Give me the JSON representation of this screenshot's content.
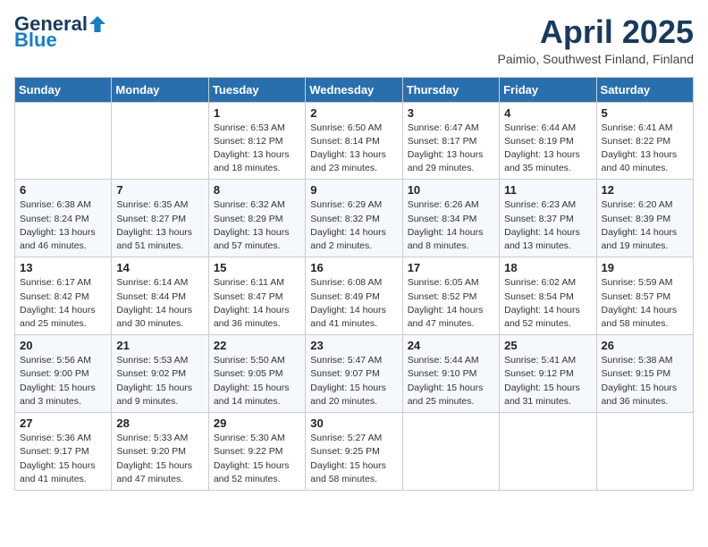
{
  "header": {
    "logo_general": "General",
    "logo_blue": "Blue",
    "month_title": "April 2025",
    "location": "Paimio, Southwest Finland, Finland"
  },
  "weekdays": [
    "Sunday",
    "Monday",
    "Tuesday",
    "Wednesday",
    "Thursday",
    "Friday",
    "Saturday"
  ],
  "weeks": [
    [
      {
        "day": "",
        "info": ""
      },
      {
        "day": "",
        "info": ""
      },
      {
        "day": "1",
        "info": "Sunrise: 6:53 AM\nSunset: 8:12 PM\nDaylight: 13 hours\nand 18 minutes."
      },
      {
        "day": "2",
        "info": "Sunrise: 6:50 AM\nSunset: 8:14 PM\nDaylight: 13 hours\nand 23 minutes."
      },
      {
        "day": "3",
        "info": "Sunrise: 6:47 AM\nSunset: 8:17 PM\nDaylight: 13 hours\nand 29 minutes."
      },
      {
        "day": "4",
        "info": "Sunrise: 6:44 AM\nSunset: 8:19 PM\nDaylight: 13 hours\nand 35 minutes."
      },
      {
        "day": "5",
        "info": "Sunrise: 6:41 AM\nSunset: 8:22 PM\nDaylight: 13 hours\nand 40 minutes."
      }
    ],
    [
      {
        "day": "6",
        "info": "Sunrise: 6:38 AM\nSunset: 8:24 PM\nDaylight: 13 hours\nand 46 minutes."
      },
      {
        "day": "7",
        "info": "Sunrise: 6:35 AM\nSunset: 8:27 PM\nDaylight: 13 hours\nand 51 minutes."
      },
      {
        "day": "8",
        "info": "Sunrise: 6:32 AM\nSunset: 8:29 PM\nDaylight: 13 hours\nand 57 minutes."
      },
      {
        "day": "9",
        "info": "Sunrise: 6:29 AM\nSunset: 8:32 PM\nDaylight: 14 hours\nand 2 minutes."
      },
      {
        "day": "10",
        "info": "Sunrise: 6:26 AM\nSunset: 8:34 PM\nDaylight: 14 hours\nand 8 minutes."
      },
      {
        "day": "11",
        "info": "Sunrise: 6:23 AM\nSunset: 8:37 PM\nDaylight: 14 hours\nand 13 minutes."
      },
      {
        "day": "12",
        "info": "Sunrise: 6:20 AM\nSunset: 8:39 PM\nDaylight: 14 hours\nand 19 minutes."
      }
    ],
    [
      {
        "day": "13",
        "info": "Sunrise: 6:17 AM\nSunset: 8:42 PM\nDaylight: 14 hours\nand 25 minutes."
      },
      {
        "day": "14",
        "info": "Sunrise: 6:14 AM\nSunset: 8:44 PM\nDaylight: 14 hours\nand 30 minutes."
      },
      {
        "day": "15",
        "info": "Sunrise: 6:11 AM\nSunset: 8:47 PM\nDaylight: 14 hours\nand 36 minutes."
      },
      {
        "day": "16",
        "info": "Sunrise: 6:08 AM\nSunset: 8:49 PM\nDaylight: 14 hours\nand 41 minutes."
      },
      {
        "day": "17",
        "info": "Sunrise: 6:05 AM\nSunset: 8:52 PM\nDaylight: 14 hours\nand 47 minutes."
      },
      {
        "day": "18",
        "info": "Sunrise: 6:02 AM\nSunset: 8:54 PM\nDaylight: 14 hours\nand 52 minutes."
      },
      {
        "day": "19",
        "info": "Sunrise: 5:59 AM\nSunset: 8:57 PM\nDaylight: 14 hours\nand 58 minutes."
      }
    ],
    [
      {
        "day": "20",
        "info": "Sunrise: 5:56 AM\nSunset: 9:00 PM\nDaylight: 15 hours\nand 3 minutes."
      },
      {
        "day": "21",
        "info": "Sunrise: 5:53 AM\nSunset: 9:02 PM\nDaylight: 15 hours\nand 9 minutes."
      },
      {
        "day": "22",
        "info": "Sunrise: 5:50 AM\nSunset: 9:05 PM\nDaylight: 15 hours\nand 14 minutes."
      },
      {
        "day": "23",
        "info": "Sunrise: 5:47 AM\nSunset: 9:07 PM\nDaylight: 15 hours\nand 20 minutes."
      },
      {
        "day": "24",
        "info": "Sunrise: 5:44 AM\nSunset: 9:10 PM\nDaylight: 15 hours\nand 25 minutes."
      },
      {
        "day": "25",
        "info": "Sunrise: 5:41 AM\nSunset: 9:12 PM\nDaylight: 15 hours\nand 31 minutes."
      },
      {
        "day": "26",
        "info": "Sunrise: 5:38 AM\nSunset: 9:15 PM\nDaylight: 15 hours\nand 36 minutes."
      }
    ],
    [
      {
        "day": "27",
        "info": "Sunrise: 5:36 AM\nSunset: 9:17 PM\nDaylight: 15 hours\nand 41 minutes."
      },
      {
        "day": "28",
        "info": "Sunrise: 5:33 AM\nSunset: 9:20 PM\nDaylight: 15 hours\nand 47 minutes."
      },
      {
        "day": "29",
        "info": "Sunrise: 5:30 AM\nSunset: 9:22 PM\nDaylight: 15 hours\nand 52 minutes."
      },
      {
        "day": "30",
        "info": "Sunrise: 5:27 AM\nSunset: 9:25 PM\nDaylight: 15 hours\nand 58 minutes."
      },
      {
        "day": "",
        "info": ""
      },
      {
        "day": "",
        "info": ""
      },
      {
        "day": "",
        "info": ""
      }
    ]
  ]
}
